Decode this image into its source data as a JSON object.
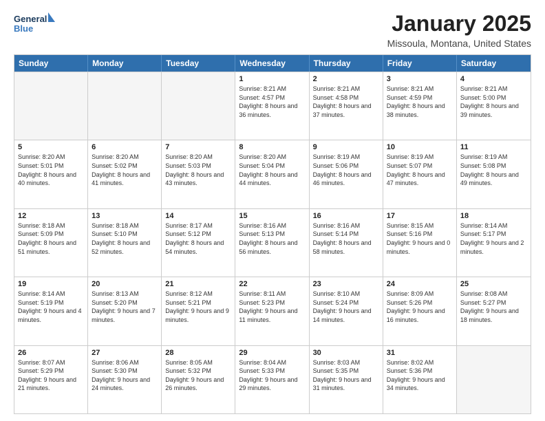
{
  "logo": {
    "line1": "General",
    "line2": "Blue"
  },
  "title": "January 2025",
  "location": "Missoula, Montana, United States",
  "days_of_week": [
    "Sunday",
    "Monday",
    "Tuesday",
    "Wednesday",
    "Thursday",
    "Friday",
    "Saturday"
  ],
  "weeks": [
    [
      {
        "day": "",
        "empty": true
      },
      {
        "day": "",
        "empty": true
      },
      {
        "day": "",
        "empty": true
      },
      {
        "day": "1",
        "sunrise": "8:21 AM",
        "sunset": "4:57 PM",
        "daylight": "8 hours and 36 minutes."
      },
      {
        "day": "2",
        "sunrise": "8:21 AM",
        "sunset": "4:58 PM",
        "daylight": "8 hours and 37 minutes."
      },
      {
        "day": "3",
        "sunrise": "8:21 AM",
        "sunset": "4:59 PM",
        "daylight": "8 hours and 38 minutes."
      },
      {
        "day": "4",
        "sunrise": "8:21 AM",
        "sunset": "5:00 PM",
        "daylight": "8 hours and 39 minutes."
      }
    ],
    [
      {
        "day": "5",
        "sunrise": "8:20 AM",
        "sunset": "5:01 PM",
        "daylight": "8 hours and 40 minutes."
      },
      {
        "day": "6",
        "sunrise": "8:20 AM",
        "sunset": "5:02 PM",
        "daylight": "8 hours and 41 minutes."
      },
      {
        "day": "7",
        "sunrise": "8:20 AM",
        "sunset": "5:03 PM",
        "daylight": "8 hours and 43 minutes."
      },
      {
        "day": "8",
        "sunrise": "8:20 AM",
        "sunset": "5:04 PM",
        "daylight": "8 hours and 44 minutes."
      },
      {
        "day": "9",
        "sunrise": "8:19 AM",
        "sunset": "5:06 PM",
        "daylight": "8 hours and 46 minutes."
      },
      {
        "day": "10",
        "sunrise": "8:19 AM",
        "sunset": "5:07 PM",
        "daylight": "8 hours and 47 minutes."
      },
      {
        "day": "11",
        "sunrise": "8:19 AM",
        "sunset": "5:08 PM",
        "daylight": "8 hours and 49 minutes."
      }
    ],
    [
      {
        "day": "12",
        "sunrise": "8:18 AM",
        "sunset": "5:09 PM",
        "daylight": "8 hours and 51 minutes."
      },
      {
        "day": "13",
        "sunrise": "8:18 AM",
        "sunset": "5:10 PM",
        "daylight": "8 hours and 52 minutes."
      },
      {
        "day": "14",
        "sunrise": "8:17 AM",
        "sunset": "5:12 PM",
        "daylight": "8 hours and 54 minutes."
      },
      {
        "day": "15",
        "sunrise": "8:16 AM",
        "sunset": "5:13 PM",
        "daylight": "8 hours and 56 minutes."
      },
      {
        "day": "16",
        "sunrise": "8:16 AM",
        "sunset": "5:14 PM",
        "daylight": "8 hours and 58 minutes."
      },
      {
        "day": "17",
        "sunrise": "8:15 AM",
        "sunset": "5:16 PM",
        "daylight": "9 hours and 0 minutes."
      },
      {
        "day": "18",
        "sunrise": "8:14 AM",
        "sunset": "5:17 PM",
        "daylight": "9 hours and 2 minutes."
      }
    ],
    [
      {
        "day": "19",
        "sunrise": "8:14 AM",
        "sunset": "5:19 PM",
        "daylight": "9 hours and 4 minutes."
      },
      {
        "day": "20",
        "sunrise": "8:13 AM",
        "sunset": "5:20 PM",
        "daylight": "9 hours and 7 minutes."
      },
      {
        "day": "21",
        "sunrise": "8:12 AM",
        "sunset": "5:21 PM",
        "daylight": "9 hours and 9 minutes."
      },
      {
        "day": "22",
        "sunrise": "8:11 AM",
        "sunset": "5:23 PM",
        "daylight": "9 hours and 11 minutes."
      },
      {
        "day": "23",
        "sunrise": "8:10 AM",
        "sunset": "5:24 PM",
        "daylight": "9 hours and 14 minutes."
      },
      {
        "day": "24",
        "sunrise": "8:09 AM",
        "sunset": "5:26 PM",
        "daylight": "9 hours and 16 minutes."
      },
      {
        "day": "25",
        "sunrise": "8:08 AM",
        "sunset": "5:27 PM",
        "daylight": "9 hours and 18 minutes."
      }
    ],
    [
      {
        "day": "26",
        "sunrise": "8:07 AM",
        "sunset": "5:29 PM",
        "daylight": "9 hours and 21 minutes."
      },
      {
        "day": "27",
        "sunrise": "8:06 AM",
        "sunset": "5:30 PM",
        "daylight": "9 hours and 24 minutes."
      },
      {
        "day": "28",
        "sunrise": "8:05 AM",
        "sunset": "5:32 PM",
        "daylight": "9 hours and 26 minutes."
      },
      {
        "day": "29",
        "sunrise": "8:04 AM",
        "sunset": "5:33 PM",
        "daylight": "9 hours and 29 minutes."
      },
      {
        "day": "30",
        "sunrise": "8:03 AM",
        "sunset": "5:35 PM",
        "daylight": "9 hours and 31 minutes."
      },
      {
        "day": "31",
        "sunrise": "8:02 AM",
        "sunset": "5:36 PM",
        "daylight": "9 hours and 34 minutes."
      },
      {
        "day": "",
        "empty": true
      }
    ]
  ]
}
